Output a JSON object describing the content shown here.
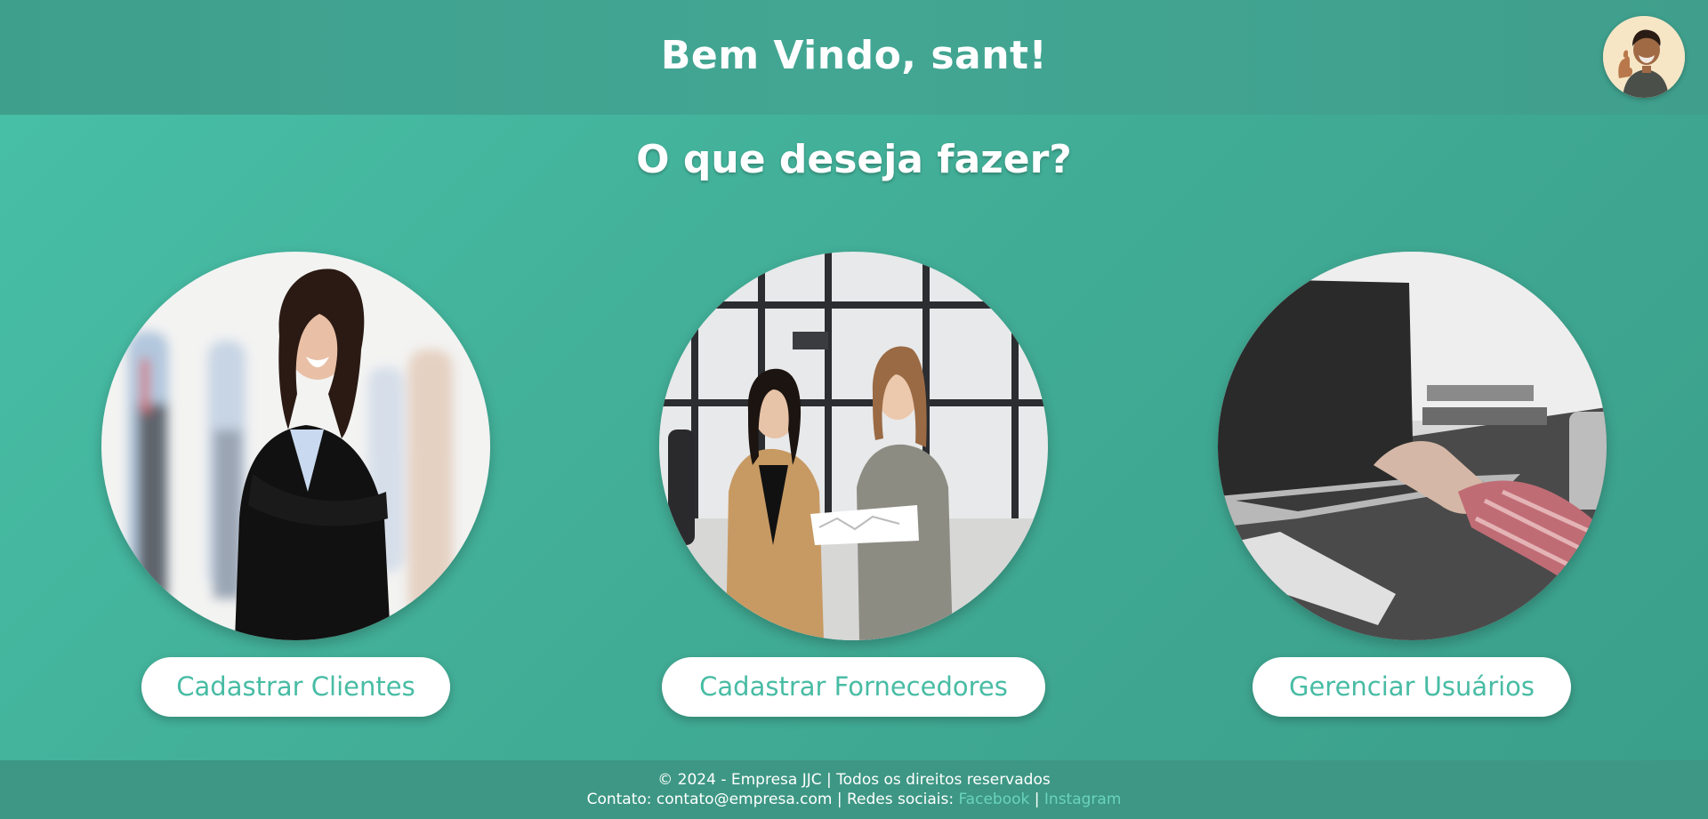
{
  "header": {
    "welcome_text": "Bem Vindo, sant!",
    "avatar_icon": "user-avatar-thumbs-up"
  },
  "main": {
    "question": "O que deseja fazer?",
    "actions": [
      {
        "label": "Cadastrar Clientes",
        "image": "businesswoman-arms-crossed-photo"
      },
      {
        "label": "Cadastrar Fornecedores",
        "image": "two-women-reviewing-document-photo"
      },
      {
        "label": "Gerenciar Usuários",
        "image": "hand-on-laptop-grayscale-photo"
      }
    ]
  },
  "footer": {
    "copyright": "© 2024 - Empresa JJC | Todos os direitos reservados",
    "contact_prefix": "Contato: contato@empresa.com | Redes sociais:",
    "separator": "|",
    "facebook": "Facebook",
    "instagram": "Instagram"
  },
  "colors": {
    "background": "#45b39d",
    "header": "#40a28f",
    "footer": "#3d9784",
    "button_text": "#48bca4",
    "link": "#6ad3bc"
  }
}
